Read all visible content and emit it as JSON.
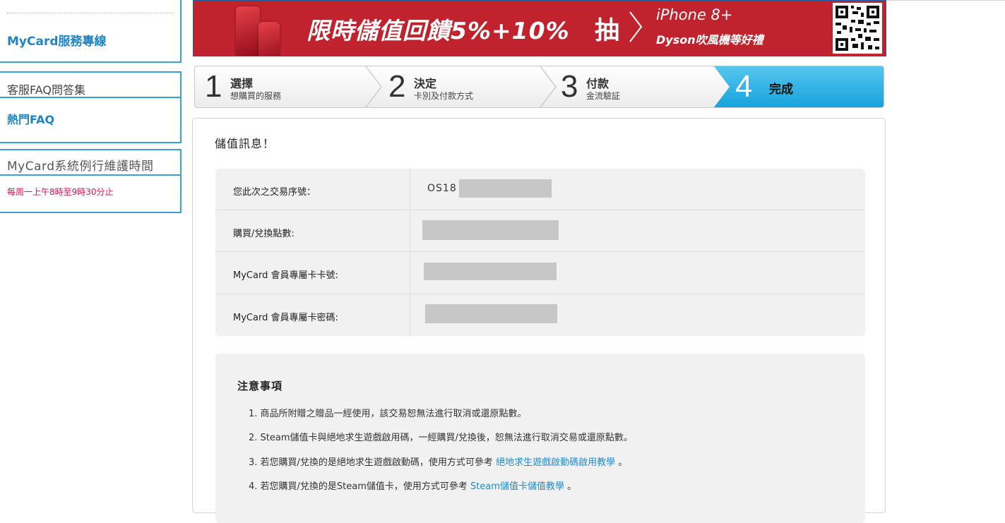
{
  "sidebar": {
    "service_title": "MyCard服務專線",
    "faq_title": "客服FAQ問答集",
    "hot_faq": "熱門FAQ",
    "maintenance_title": "MyCard系統例行維護時間",
    "maintenance_time": "每周一上午8時至9時30分止"
  },
  "banner": {
    "main": "限時儲值回饋5%+10%",
    "draw": "抽",
    "line1": "iPhone 8+",
    "line2": "Dyson吹風機等好禮"
  },
  "steps": [
    {
      "num": "1",
      "title": "選擇",
      "sub": "想購買的服務"
    },
    {
      "num": "2",
      "title": "決定",
      "sub": "卡別及付款方式"
    },
    {
      "num": "3",
      "title": "付款",
      "sub": "金流驗証"
    },
    {
      "num": "4",
      "title": "完成",
      "sub": ""
    }
  ],
  "panel": {
    "title": "儲值訊息！",
    "rows": [
      {
        "label": "您此次之交易序號：",
        "value": "OS18"
      },
      {
        "label": "購買/兌換點數:",
        "value": ""
      },
      {
        "label": "MyCard 會員專屬卡卡號:",
        "value": ""
      },
      {
        "label": "MyCard 會員專屬卡密碼:",
        "value": ""
      }
    ]
  },
  "notes": {
    "title": "注意事項",
    "items": [
      {
        "text": "1. 商品所附贈之贈品一經使用，該交易恕無法進行取消或還原點數。",
        "link": "",
        "suffix": ""
      },
      {
        "text": "2. Steam儲值卡與絕地求生遊戲啟用碼，一經購買/兌換後，恕無法進行取消交易或還原點數。",
        "link": "",
        "suffix": ""
      },
      {
        "text": "3. 若您購買/兌換的是絕地求生遊戲啟動碼，使用方式可參考 ",
        "link": "絕地求生遊戲啟動碼啟用教學",
        "suffix": " 。"
      },
      {
        "text": "4. 若您購買/兌換的是Steam儲值卡，使用方式可參考 ",
        "link": "Steam儲值卡儲值教學",
        "suffix": " 。"
      }
    ]
  },
  "colors": {
    "accent_blue": "#1e86c6",
    "banner_red": "#c1232e",
    "step_active": "#16a3dd",
    "maintenance_red": "#e0114d"
  }
}
